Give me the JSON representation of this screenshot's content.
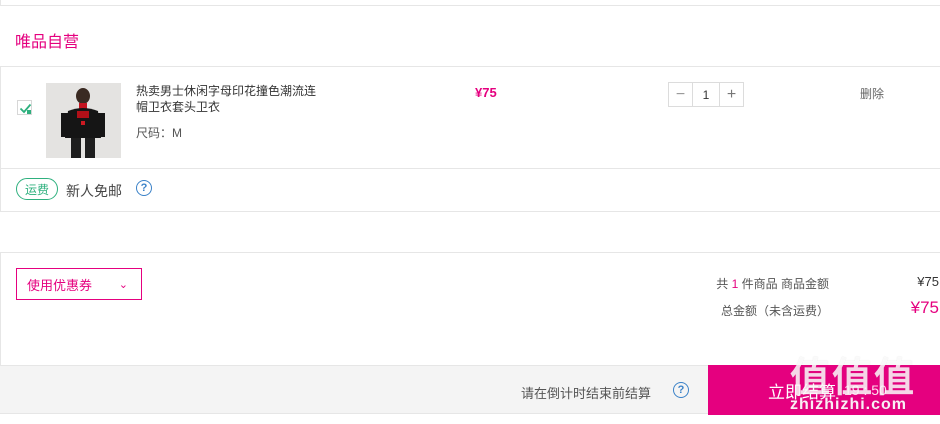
{
  "store": {
    "title": "唯品自营"
  },
  "item": {
    "selected": true,
    "name": "热卖男士休闲字母印花撞色潮流连帽卫衣套头卫衣",
    "spec": "尺码：M",
    "price": "¥75",
    "quantity": "1",
    "minus": "−",
    "plus": "+",
    "delete_label": "删除"
  },
  "shipping": {
    "badge": "运费",
    "text": "新人免邮",
    "help": "?"
  },
  "coupon": {
    "label": "使用优惠券",
    "chevron": "⌄"
  },
  "summary": {
    "count_prefix": "共",
    "count": "1",
    "count_suffix": "件商品  商品金额",
    "goods_amount": "¥75",
    "total_label": "总金额（未含运费）",
    "total_amount": "¥75"
  },
  "footer": {
    "countdown_tip": "请在倒计时结束前结算",
    "help": "?",
    "checkout_label": "立即结算",
    "timer": "19 : 50"
  },
  "watermark": {
    "big": "值值值",
    "small": "zhizhizhi.com"
  },
  "colors": {
    "accent": "#e5007f",
    "shipping_green": "#2eb07e",
    "help_blue": "#3b82c8"
  }
}
